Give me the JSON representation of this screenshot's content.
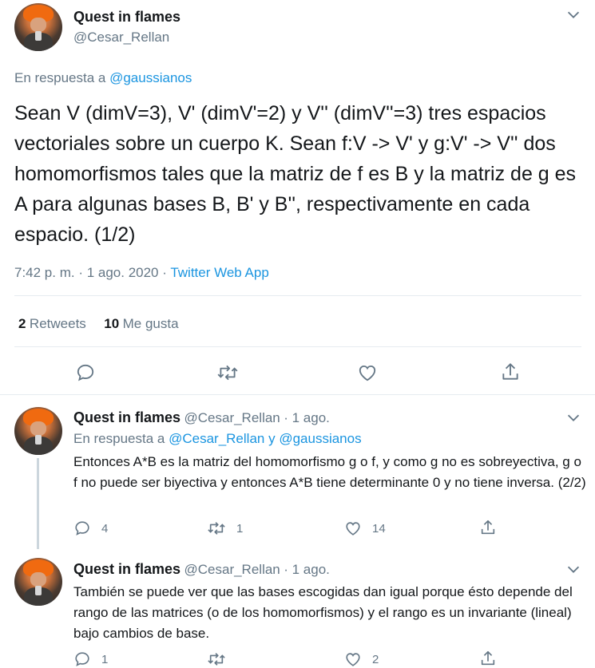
{
  "main_tweet": {
    "author_name": "Quest in flames",
    "author_handle": "@Cesar_Rellan",
    "reply_prefix": "En respuesta a",
    "reply_to": "@gaussianos",
    "text": "Sean V (dimV=3), V' (dimV'=2) y V'' (dimV''=3) tres espacios vectoriales sobre un cuerpo K. Sean f:V -> V' y g:V' -> V'' dos homomorfismos tales que la matriz de f es B y la matriz de g es A para algunas bases B, B' y B'', respectivamente en cada espacio. (1/2)",
    "time": "7:42 p. m. · 1 ago. 2020 ·",
    "source": "Twitter Web App",
    "retweets_count": "2",
    "retweets_label": "Retweets",
    "likes_count": "10",
    "likes_label": "Me gusta"
  },
  "replies": [
    {
      "author_name": "Quest in flames",
      "author_handle": "@Cesar_Rellan",
      "date": "· 1 ago.",
      "reply_prefix": "En respuesta a",
      "reply_to_1": "@Cesar_Rellan",
      "reply_joiner": "y",
      "reply_to_2": "@gaussianos",
      "text": "Entonces A*B es la matriz del homomorfismo g o f, y como g no es sobreyectiva, g o f no puede ser biyectiva y entonces A*B tiene determinante 0 y no tiene inversa. (2/2)",
      "reply_count": "4",
      "retweet_count": "1",
      "like_count": "14"
    },
    {
      "author_name": "Quest in flames",
      "author_handle": "@Cesar_Rellan",
      "date": "· 1 ago.",
      "text": "También se puede ver que las bases escogidas dan igual porque ésto depende del rango de las matrices (o de los homomorfismos) y el rango es un invariante (lineal) bajo cambios de base.",
      "reply_count": "1",
      "retweet_count": "",
      "like_count": "2"
    }
  ],
  "colors": {
    "text": "#14171a",
    "secondary": "#657786",
    "link": "#1b95e0",
    "divider": "#e6ecf0"
  }
}
